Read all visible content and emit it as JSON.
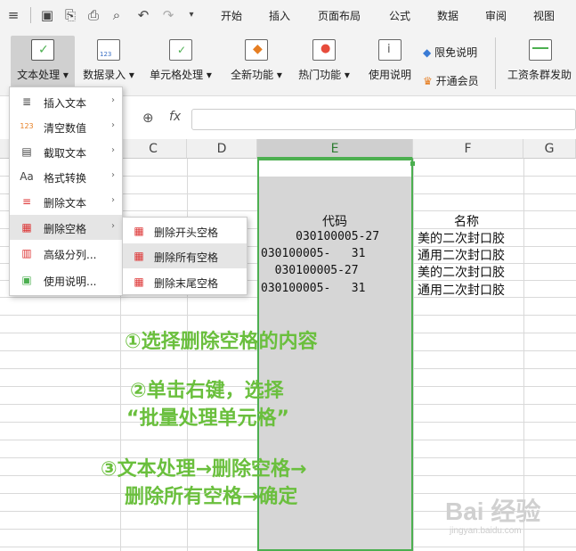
{
  "menu_tabs": [
    "开始",
    "插入",
    "页面布局",
    "公式",
    "数据",
    "审阅",
    "视图"
  ],
  "ribbon": {
    "text_process": "文本处理",
    "data_entry": "数据录入",
    "cell_process": "单元格处理",
    "new_features": "全新功能",
    "hot_features": "热门功能",
    "usage_guide": "使用说明",
    "disclaimer": "限免说明",
    "open_member": "开通会员",
    "salary_tool": "工资条群发助"
  },
  "formula_bar": {
    "fx": "fx"
  },
  "columns": {
    "C": "C",
    "D": "D",
    "E": "E",
    "F": "F",
    "G": "G"
  },
  "dropdown": [
    {
      "label": "插入文本",
      "icon": "insert-text-icon",
      "arrow": "›"
    },
    {
      "label": "清空数值",
      "icon": "clear-values-icon",
      "arrow": "›"
    },
    {
      "label": "截取文本",
      "icon": "extract-text-icon",
      "arrow": "›"
    },
    {
      "label": "格式转换",
      "icon": "format-convert-icon",
      "arrow": "›"
    },
    {
      "label": "删除文本",
      "icon": "delete-text-icon",
      "arrow": "›"
    },
    {
      "label": "删除空格",
      "icon": "delete-space-icon",
      "arrow": "›"
    },
    {
      "label": "高级分列...",
      "icon": "advanced-split-icon",
      "arrow": ""
    },
    {
      "label": "使用说明...",
      "icon": "help-icon",
      "arrow": ""
    }
  ],
  "submenu": [
    {
      "label": "删除开头空格",
      "icon": "delete-leading-space-icon"
    },
    {
      "label": "删除所有空格",
      "icon": "delete-all-space-icon"
    },
    {
      "label": "删除末尾空格",
      "icon": "delete-trailing-space-icon"
    }
  ],
  "table": {
    "header_code": "代码",
    "header_name": "名称",
    "rows": [
      {
        "code": "     030100005-27",
        "name": "美的二次封口胶"
      },
      {
        "code": "030100005-   31",
        "name": "通用二次封口胶"
      },
      {
        "code": "  030100005-27",
        "name": "美的二次封口胶"
      },
      {
        "code": "030100005-   31",
        "name": "通用二次封口胶"
      }
    ]
  },
  "notes": {
    "step1": "①选择删除空格的内容",
    "step2a": "②单击右键，选择",
    "step2b": "“批量处理单元格”",
    "step3a": "③文本处理→删除空格→",
    "step3b": "删除所有空格→确定"
  },
  "watermark": {
    "main": "Bai 经验",
    "sub": "jingyan.baidu.com"
  }
}
